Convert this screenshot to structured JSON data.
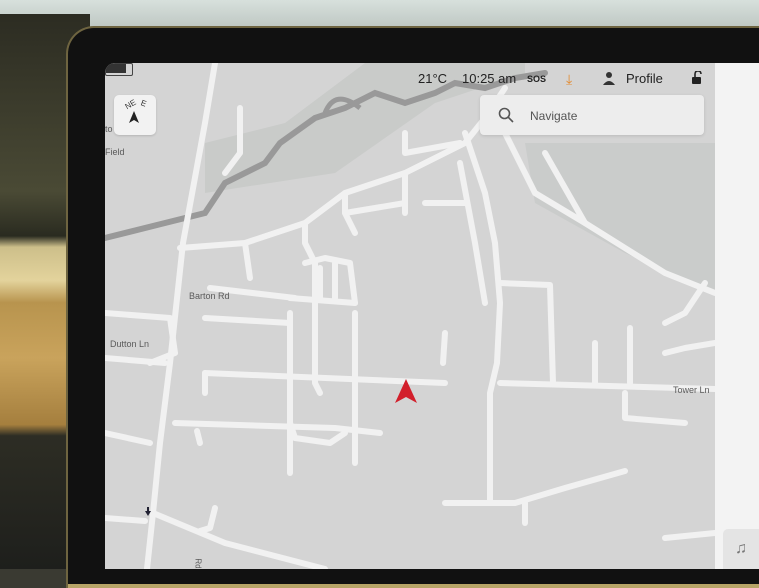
{
  "status_bar": {
    "temperature": "21°C",
    "time": "10:25 am",
    "sos_label": "SOS",
    "download_icon": "download-icon",
    "profile_label": "Profile",
    "lock_icon": "unlocked-padlock-icon",
    "battery_level": 0.85
  },
  "compass": {
    "north_label": "NE",
    "east_label": "E"
  },
  "search": {
    "placeholder": "Navigate"
  },
  "map": {
    "labels": {
      "field_top": "to",
      "field_bottom": "Field",
      "barton_rd": "Barton Rd",
      "dutton_ln": "Dutton Ln",
      "tower_ln": "Tower Ln",
      "rd": "Rd"
    }
  },
  "colors": {
    "map_background": "#d4d4d4",
    "road": "#f1f1f1",
    "river": "#9a9a9a",
    "park": "#c6c8c6",
    "nav_arrow": "#d21f2b",
    "accent_download": "#e38a2e"
  },
  "dock": {
    "music_icon": "music-note-icon"
  }
}
